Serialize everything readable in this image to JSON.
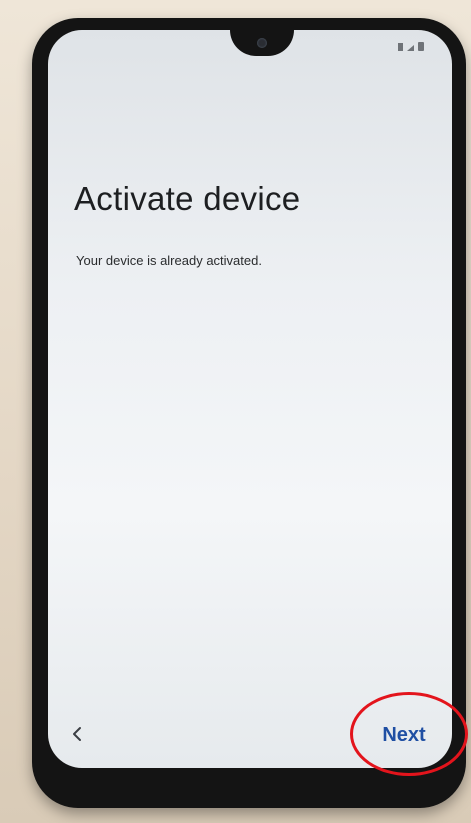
{
  "screen": {
    "title": "Activate device",
    "message": "Your device is already activated."
  },
  "navigation": {
    "back_icon": "chevron-left-icon",
    "next_label": "Next"
  },
  "status_bar": {
    "icons": [
      "signal-icon",
      "cell-signal-icon",
      "battery-icon"
    ]
  },
  "annotation": {
    "highlight_color": "#e3141c",
    "highlight_target": "next-button"
  },
  "colors": {
    "accent": "#1f4fa3",
    "title_text": "#1d1f21"
  }
}
